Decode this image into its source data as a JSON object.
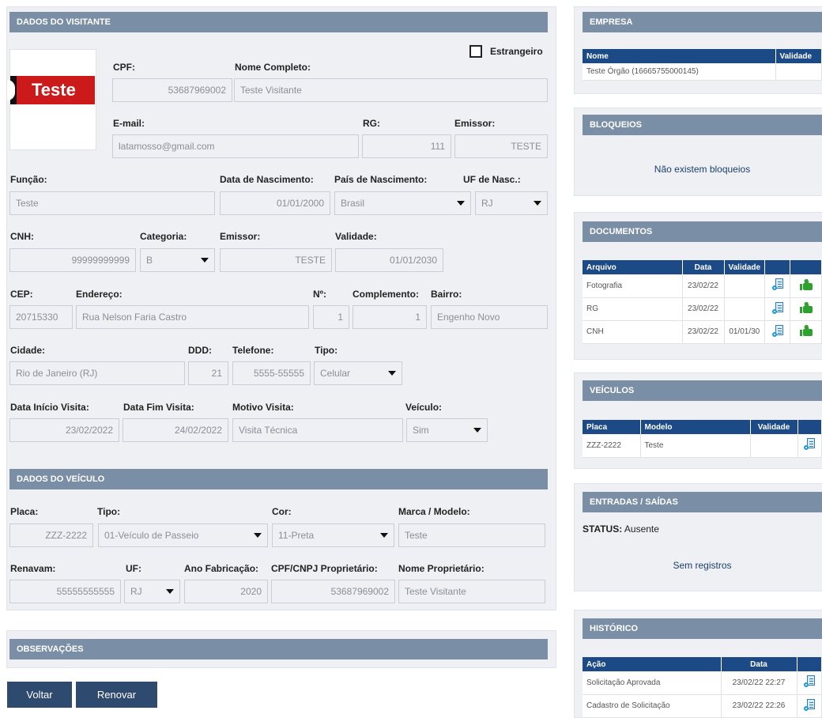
{
  "visitor": {
    "header": "DADOS DO VISITANTE",
    "photo_text": "Teste",
    "estrangeiro_label": "Estrangeiro",
    "cpf_label": "CPF:",
    "cpf": "53687969002",
    "nome_label": "Nome Completo:",
    "nome": "Teste Visitante",
    "email_label": "E-mail:",
    "email": "latamosso@gmail.com",
    "rg_label": "RG:",
    "rg": "111",
    "emissor_label": "Emissor:",
    "emissor": "TESTE",
    "funcao_label": "Função:",
    "funcao": "Teste",
    "nascimento_label": "Data de Nascimento:",
    "nascimento": "01/01/2000",
    "pais_label": "País de Nascimento:",
    "pais": "Brasil",
    "uf_nasc_label": "UF de Nasc.:",
    "uf_nasc": "RJ",
    "cnh_label": "CNH:",
    "cnh": "99999999999",
    "categoria_label": "Categoria:",
    "categoria": "B",
    "cnh_emissor_label": "Emissor:",
    "cnh_emissor": "TESTE",
    "validade_label": "Validade:",
    "validade": "01/01/2030",
    "cep_label": "CEP:",
    "cep": "20715330",
    "endereco_label": "Endereço:",
    "endereco": "Rua Nelson Faria Castro",
    "numero_label": "Nº:",
    "numero": "1",
    "complemento_label": "Complemento:",
    "complemento": "1",
    "bairro_label": "Bairro:",
    "bairro": "Engenho Novo",
    "cidade_label": "Cidade:",
    "cidade": "Rio de Janeiro (RJ)",
    "ddd_label": "DDD:",
    "ddd": "21",
    "telefone_label": "Telefone:",
    "telefone": "5555-55555",
    "tipo_label": "Tipo:",
    "tipo": "Celular",
    "inicio_label": "Data Início Visita:",
    "inicio": "23/02/2022",
    "fim_label": "Data Fim Visita:",
    "fim": "24/02/2022",
    "motivo_label": "Motivo Visita:",
    "motivo": "Visita Técnica",
    "veiculo_label": "Veículo:",
    "veiculo": "Sim"
  },
  "vehicle": {
    "header": "DADOS DO VEÍCULO",
    "placa_label": "Placa:",
    "placa": "ZZZ-2222",
    "tipo_label": "Tipo:",
    "tipo": "01-Veículo de Passeio",
    "cor_label": "Cor:",
    "cor": "11-Preta",
    "marca_label": "Marca / Modelo:",
    "marca": "Teste",
    "renavam_label": "Renavam:",
    "renavam": "55555555555",
    "uf_label": "UF:",
    "uf": "RJ",
    "ano_label": "Ano Fabricação:",
    "ano": "2020",
    "cpf_prop_label": "CPF/CNPJ Proprietário:",
    "cpf_prop": "53687969002",
    "nome_prop_label": "Nome Proprietário:",
    "nome_prop": "Teste Visitante"
  },
  "observacoes": {
    "header": "OBSERVAÇÕES"
  },
  "buttons": {
    "voltar": "Voltar",
    "renovar": "Renovar"
  },
  "empresa": {
    "header": "EMPRESA",
    "col_nome": "Nome",
    "col_validade": "Validade",
    "rows": [
      {
        "nome": "Teste Órgão (16665755000145)",
        "validade": ""
      }
    ]
  },
  "bloqueios": {
    "header": "BLOQUEIOS",
    "empty": "Não existem bloqueios"
  },
  "documentos": {
    "header": "DOCUMENTOS",
    "col_arquivo": "Arquivo",
    "col_data": "Data",
    "col_validade": "Validade",
    "rows": [
      {
        "arquivo": "Fotografia",
        "data": "23/02/22",
        "validade": ""
      },
      {
        "arquivo": "RG",
        "data": "23/02/22",
        "validade": ""
      },
      {
        "arquivo": "CNH",
        "data": "23/02/22",
        "validade": "01/01/30"
      }
    ]
  },
  "veiculos": {
    "header": "VEÍCULOS",
    "col_placa": "Placa",
    "col_modelo": "Modelo",
    "col_validade": "Validade",
    "rows": [
      {
        "placa": "ZZZ-2222",
        "modelo": "Teste",
        "validade": ""
      }
    ]
  },
  "entradas": {
    "header": "ENTRADAS / SAÍDAS",
    "status_label": "STATUS:",
    "status": "Ausente",
    "empty": "Sem registros"
  },
  "historico": {
    "header": "HISTÓRICO",
    "col_acao": "Ação",
    "col_data": "Data",
    "rows": [
      {
        "acao": "Solicitação Aprovada",
        "data": "23/02/22 22:27"
      },
      {
        "acao": "Cadastro de Solicitação",
        "data": "23/02/22 22:26"
      }
    ]
  }
}
